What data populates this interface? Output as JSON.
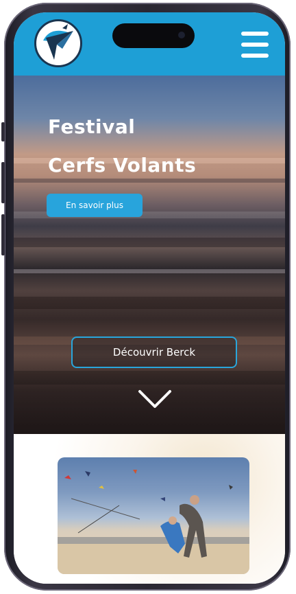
{
  "header": {
    "logo_icon": "kite-bird-logo",
    "menu_icon": "hamburger-menu-icon",
    "color": "#1e9fd6"
  },
  "hero": {
    "title_line1": "Festival",
    "title_line2": "Cerfs Volants",
    "more_button": "En savoir plus",
    "discover_button": "Découvrir Berck",
    "scroll_icon": "chevron-down-icon"
  },
  "content": {
    "photo": "kite-flyers-on-beach-photo"
  }
}
